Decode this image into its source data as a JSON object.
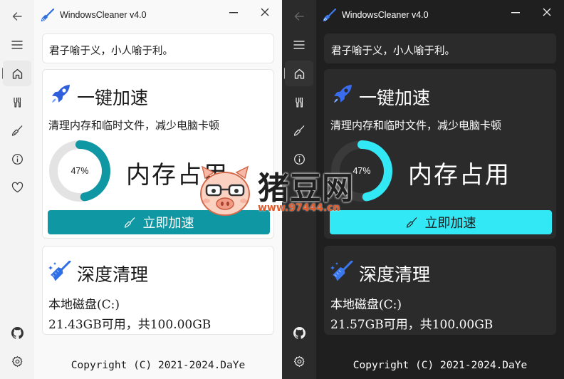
{
  "app": {
    "title": "WindowsCleaner v4.0"
  },
  "quote": "君子喻于义，小人喻于利。",
  "boost": {
    "title": "一键加速",
    "description": "清理内存和临时文件，减少电脑卡顿",
    "memory_label": "内存占用",
    "memory_usage_percent": 47,
    "memory_usage_text": "47%",
    "button_label": "立即加速"
  },
  "deep_clean": {
    "title": "深度清理",
    "disk_name": "本地磁盘(C:)",
    "light_disk_info": "21.43GB可用，共100.00GB",
    "dark_disk_info": "21.57GB可用，共100.00GB"
  },
  "copyright": "Copyright (C) 2021-2024.DaYe",
  "nav_icons": [
    "back-icon",
    "menu-icon",
    "home-icon",
    "tools-icon",
    "brush-icon",
    "info-icon",
    "heart-icon",
    "github-icon",
    "settings-icon"
  ],
  "watermark": {
    "brand": "猪豆网",
    "url": "www.97444.cn"
  },
  "colors": {
    "light_accent": "#0f97a3",
    "dark_accent": "#33e8f5",
    "gauge_track_light": "#e3e3e3",
    "gauge_track_dark": "#3a3a3a"
  }
}
